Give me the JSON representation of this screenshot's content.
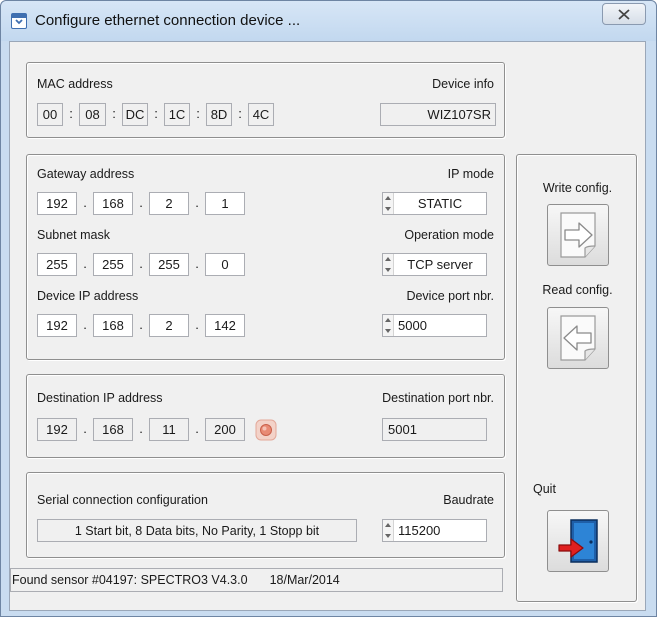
{
  "window": {
    "title": "Configure ethernet connection device ..."
  },
  "mac": {
    "label": "MAC address",
    "octets": [
      "00",
      "08",
      "DC",
      "1C",
      "8D",
      "4C"
    ],
    "separator": ":"
  },
  "device_info": {
    "label": "Device info",
    "value": "WIZ107SR"
  },
  "network": {
    "gateway_label": "Gateway address",
    "gateway": [
      "192",
      "168",
      "2",
      "1"
    ],
    "subnet_label": "Subnet mask",
    "subnet": [
      "255",
      "255",
      "255",
      "0"
    ],
    "device_ip_label": "Device IP address",
    "device_ip": [
      "192",
      "168",
      "2",
      "142"
    ],
    "ip_separator": ".",
    "ip_mode_label": "IP mode",
    "ip_mode": "STATIC",
    "operation_mode_label": "Operation mode",
    "operation_mode": "TCP server",
    "device_port_label": "Device port nbr.",
    "device_port": "5000"
  },
  "destination": {
    "ip_label": "Destination IP address",
    "ip": [
      "192",
      "168",
      "11",
      "200"
    ],
    "port_label": "Destination port nbr.",
    "port": "5001"
  },
  "serial": {
    "label": "Serial connection configuration",
    "config": "1 Start bit, 8 Data bits, No Parity, 1 Stopp bit",
    "baudrate_label": "Baudrate",
    "baudrate": "115200"
  },
  "actions": {
    "write_label": "Write config.",
    "read_label": "Read config.",
    "quit_label": "Quit"
  },
  "status": {
    "found": "Found sensor #04197: SPECTRO3 V4.3.0",
    "date": "18/Mar/2014"
  },
  "icons": {
    "title": "window-app-icon",
    "close": "close-icon",
    "write": "page-arrow-right-icon",
    "read": "page-arrow-left-icon",
    "quit": "exit-door-icon",
    "ping": "ping-icon"
  }
}
